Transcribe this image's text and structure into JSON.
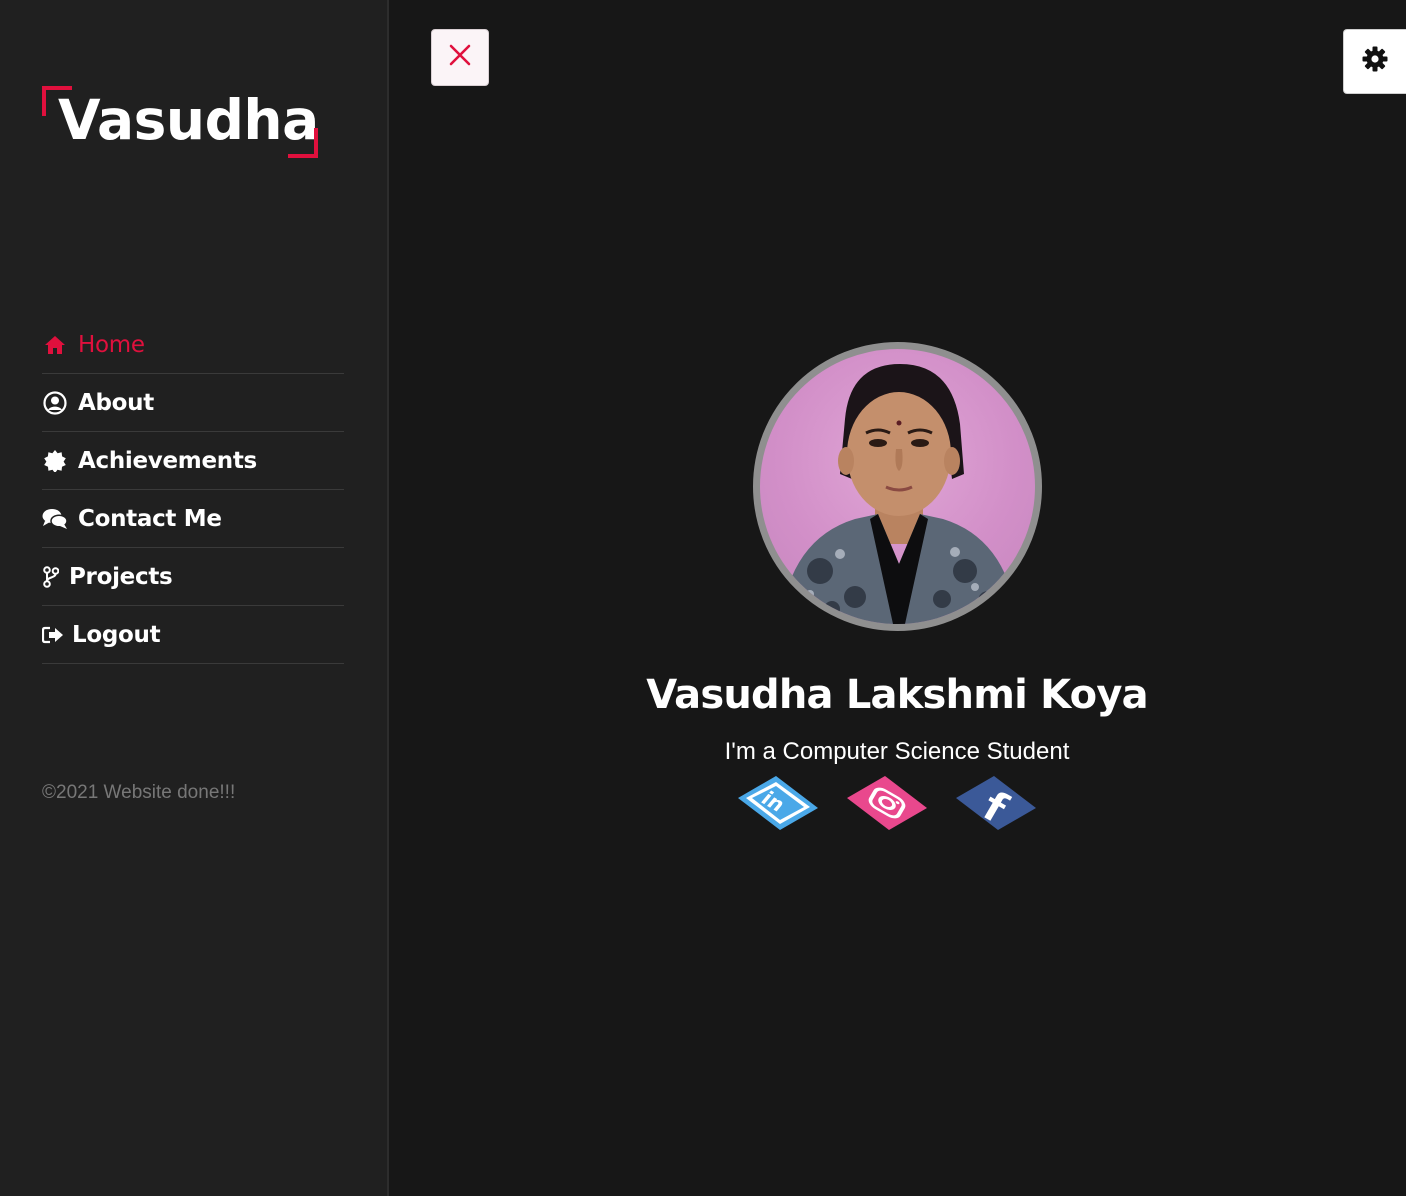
{
  "sidebar": {
    "logo": "Vasudha",
    "nav": [
      {
        "label": "Home",
        "icon": "home-icon",
        "active": true
      },
      {
        "label": "About",
        "icon": "user-circle-icon",
        "active": false
      },
      {
        "label": "Achievements",
        "icon": "badge-icon",
        "active": false
      },
      {
        "label": "Contact Me",
        "icon": "comments-icon",
        "active": false
      },
      {
        "label": "Projects",
        "icon": "code-branch-icon",
        "active": false
      },
      {
        "label": "Logout",
        "icon": "sign-out-icon",
        "active": false
      }
    ],
    "copyright": "©2021 Website done!!!"
  },
  "toolbar": {
    "close_icon": "close-icon",
    "settings_icon": "gear-icon"
  },
  "profile": {
    "name": "Vasudha Lakshmi Koya",
    "tagline": "I'm a Computer Science Student",
    "socials": [
      {
        "name": "linkedin",
        "icon": "linkedin-icon"
      },
      {
        "name": "instagram",
        "icon": "instagram-icon"
      },
      {
        "name": "facebook",
        "icon": "facebook-icon"
      }
    ]
  },
  "colors": {
    "accent": "#e0103d",
    "sidebar_bg": "#202020",
    "main_bg": "#171717",
    "linkedin": "#4aa8e8",
    "instagram": "#e9488d",
    "facebook": "#3b5998"
  }
}
